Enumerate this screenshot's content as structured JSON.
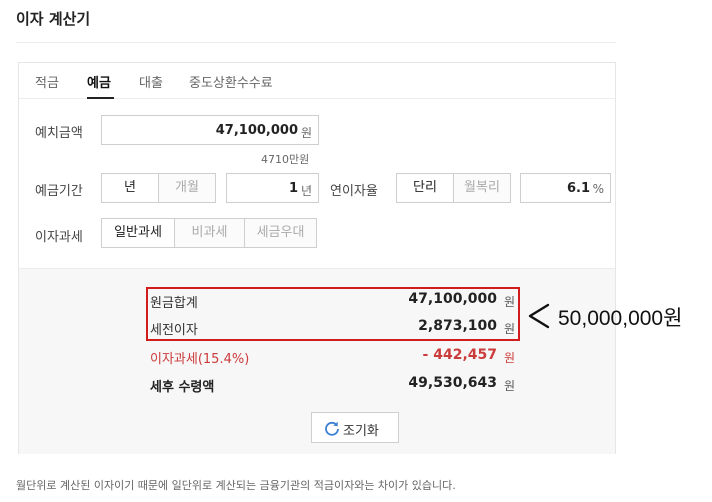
{
  "app": {
    "title": "이자 계산기"
  },
  "tabs": [
    {
      "label": "적금",
      "active": false
    },
    {
      "label": "예금",
      "active": true
    },
    {
      "label": "대출",
      "active": false
    },
    {
      "label": "중도상환수수료",
      "active": false
    }
  ],
  "deposit": {
    "label": "예치금액",
    "value": "47,100,000",
    "unit": "원",
    "hint": "4710만원"
  },
  "period": {
    "label": "예금기간",
    "options": [
      "년",
      "개월"
    ],
    "selected": "년",
    "value": "1",
    "unit": "년"
  },
  "rate": {
    "label": "연이자율",
    "options": [
      "단리",
      "월복리"
    ],
    "selected": "단리",
    "value": "6.1",
    "unit": "%"
  },
  "tax": {
    "label": "이자과세",
    "options": [
      "일반과세",
      "비과세",
      "세금우대"
    ],
    "selected": "일반과세"
  },
  "summary": {
    "principal_total": {
      "label": "원금합계",
      "value": "47,100,000",
      "unit": "원"
    },
    "pretax_interest": {
      "label": "세전이자",
      "value": "2,873,100",
      "unit": "원"
    },
    "interest_tax": {
      "label": "이자과세(15.4%)",
      "value": "- 442,457",
      "unit": "원"
    },
    "net_receipt": {
      "label": "세후 수령액",
      "value": "49,530,643",
      "unit": "원"
    }
  },
  "reset_label": "조기화",
  "footnote": "월단위로 계산된 이자이기 때문에 일단위로 계산되는 금융기관의 적금이자와는 차이가 있습니다.",
  "annotation": {
    "text": "50,000,000원"
  },
  "colors": {
    "highlight": "#d21c1c",
    "tax_red": "#cc3b3b",
    "accent_blue": "#3b7fd1"
  }
}
